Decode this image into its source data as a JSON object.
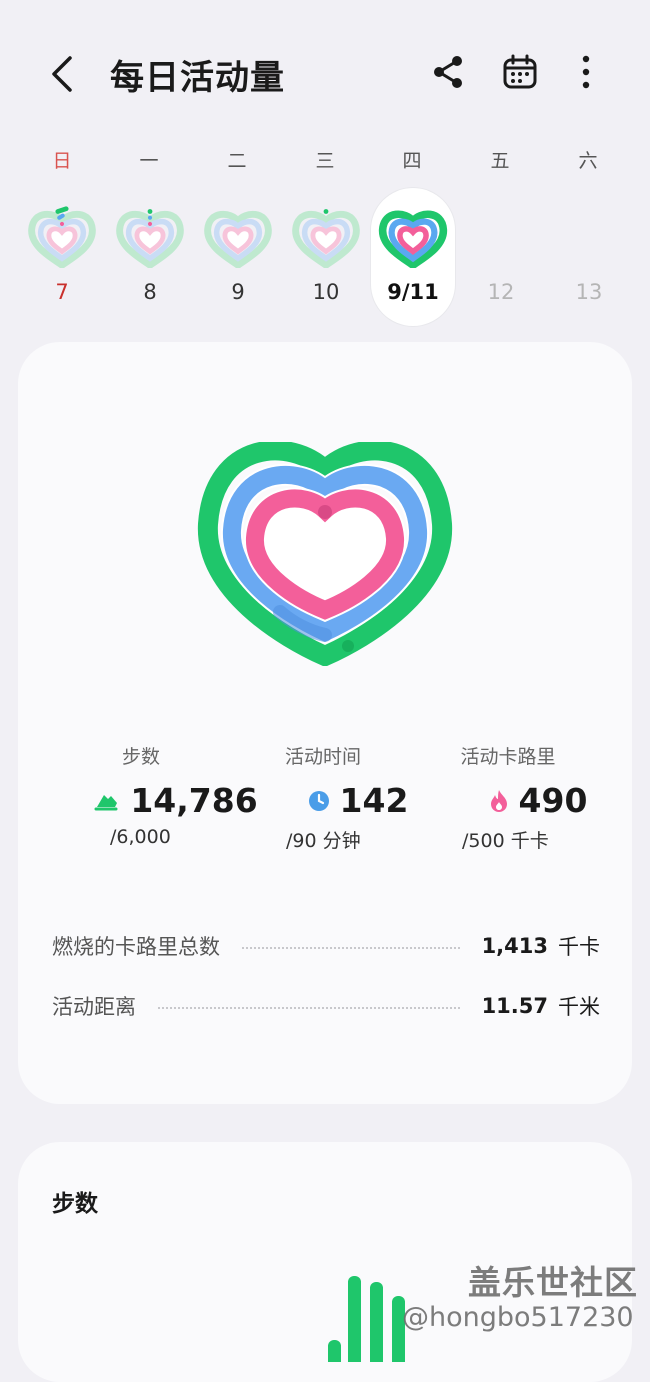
{
  "header": {
    "title": "每日活动量",
    "back_icon": "chevron-left-icon",
    "share_icon": "share-icon",
    "calendar_icon": "calendar-icon",
    "more_icon": "more-vertical-icon"
  },
  "week": {
    "weekdays": [
      "日",
      "一",
      "二",
      "三",
      "四",
      "五",
      "六"
    ],
    "dates": [
      "7",
      "8",
      "9",
      "10",
      "9/11",
      "12",
      "13"
    ],
    "selected_index": 4
  },
  "summary": {
    "steps": {
      "label": "步数",
      "value": "14,786",
      "goal": "/6,000",
      "icon": "shoe-icon",
      "color": "#1fc66b"
    },
    "active_time": {
      "label": "活动时间",
      "value": "142",
      "goal": "/90 分钟",
      "icon": "clock-icon",
      "color": "#4a9de8"
    },
    "active_calories": {
      "label": "活动卡路里",
      "value": "490",
      "goal": "/500 千卡",
      "icon": "flame-icon",
      "color": "#f35f9a"
    },
    "total_calories": {
      "label": "燃烧的卡路里总数",
      "value": "1,413",
      "unit": "千卡"
    },
    "distance": {
      "label": "活动距离",
      "value": "11.57",
      "unit": "千米"
    }
  },
  "steps_card": {
    "title": "步数"
  },
  "watermark": {
    "line1": "盖乐世社区",
    "line2": "@hongbo517230"
  }
}
